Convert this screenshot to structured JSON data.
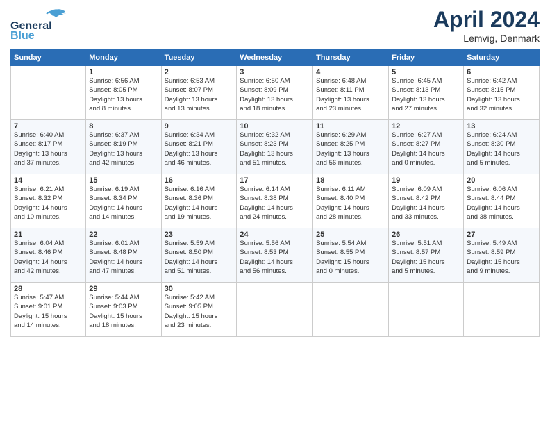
{
  "header": {
    "logo_general": "General",
    "logo_blue": "Blue",
    "title": "April 2024",
    "location": "Lemvig, Denmark"
  },
  "days_of_week": [
    "Sunday",
    "Monday",
    "Tuesday",
    "Wednesday",
    "Thursday",
    "Friday",
    "Saturday"
  ],
  "weeks": [
    [
      {
        "day": "",
        "info": ""
      },
      {
        "day": "1",
        "info": "Sunrise: 6:56 AM\nSunset: 8:05 PM\nDaylight: 13 hours\nand 8 minutes."
      },
      {
        "day": "2",
        "info": "Sunrise: 6:53 AM\nSunset: 8:07 PM\nDaylight: 13 hours\nand 13 minutes."
      },
      {
        "day": "3",
        "info": "Sunrise: 6:50 AM\nSunset: 8:09 PM\nDaylight: 13 hours\nand 18 minutes."
      },
      {
        "day": "4",
        "info": "Sunrise: 6:48 AM\nSunset: 8:11 PM\nDaylight: 13 hours\nand 23 minutes."
      },
      {
        "day": "5",
        "info": "Sunrise: 6:45 AM\nSunset: 8:13 PM\nDaylight: 13 hours\nand 27 minutes."
      },
      {
        "day": "6",
        "info": "Sunrise: 6:42 AM\nSunset: 8:15 PM\nDaylight: 13 hours\nand 32 minutes."
      }
    ],
    [
      {
        "day": "7",
        "info": "Sunrise: 6:40 AM\nSunset: 8:17 PM\nDaylight: 13 hours\nand 37 minutes."
      },
      {
        "day": "8",
        "info": "Sunrise: 6:37 AM\nSunset: 8:19 PM\nDaylight: 13 hours\nand 42 minutes."
      },
      {
        "day": "9",
        "info": "Sunrise: 6:34 AM\nSunset: 8:21 PM\nDaylight: 13 hours\nand 46 minutes."
      },
      {
        "day": "10",
        "info": "Sunrise: 6:32 AM\nSunset: 8:23 PM\nDaylight: 13 hours\nand 51 minutes."
      },
      {
        "day": "11",
        "info": "Sunrise: 6:29 AM\nSunset: 8:25 PM\nDaylight: 13 hours\nand 56 minutes."
      },
      {
        "day": "12",
        "info": "Sunrise: 6:27 AM\nSunset: 8:27 PM\nDaylight: 14 hours\nand 0 minutes."
      },
      {
        "day": "13",
        "info": "Sunrise: 6:24 AM\nSunset: 8:30 PM\nDaylight: 14 hours\nand 5 minutes."
      }
    ],
    [
      {
        "day": "14",
        "info": "Sunrise: 6:21 AM\nSunset: 8:32 PM\nDaylight: 14 hours\nand 10 minutes."
      },
      {
        "day": "15",
        "info": "Sunrise: 6:19 AM\nSunset: 8:34 PM\nDaylight: 14 hours\nand 14 minutes."
      },
      {
        "day": "16",
        "info": "Sunrise: 6:16 AM\nSunset: 8:36 PM\nDaylight: 14 hours\nand 19 minutes."
      },
      {
        "day": "17",
        "info": "Sunrise: 6:14 AM\nSunset: 8:38 PM\nDaylight: 14 hours\nand 24 minutes."
      },
      {
        "day": "18",
        "info": "Sunrise: 6:11 AM\nSunset: 8:40 PM\nDaylight: 14 hours\nand 28 minutes."
      },
      {
        "day": "19",
        "info": "Sunrise: 6:09 AM\nSunset: 8:42 PM\nDaylight: 14 hours\nand 33 minutes."
      },
      {
        "day": "20",
        "info": "Sunrise: 6:06 AM\nSunset: 8:44 PM\nDaylight: 14 hours\nand 38 minutes."
      }
    ],
    [
      {
        "day": "21",
        "info": "Sunrise: 6:04 AM\nSunset: 8:46 PM\nDaylight: 14 hours\nand 42 minutes."
      },
      {
        "day": "22",
        "info": "Sunrise: 6:01 AM\nSunset: 8:48 PM\nDaylight: 14 hours\nand 47 minutes."
      },
      {
        "day": "23",
        "info": "Sunrise: 5:59 AM\nSunset: 8:50 PM\nDaylight: 14 hours\nand 51 minutes."
      },
      {
        "day": "24",
        "info": "Sunrise: 5:56 AM\nSunset: 8:53 PM\nDaylight: 14 hours\nand 56 minutes."
      },
      {
        "day": "25",
        "info": "Sunrise: 5:54 AM\nSunset: 8:55 PM\nDaylight: 15 hours\nand 0 minutes."
      },
      {
        "day": "26",
        "info": "Sunrise: 5:51 AM\nSunset: 8:57 PM\nDaylight: 15 hours\nand 5 minutes."
      },
      {
        "day": "27",
        "info": "Sunrise: 5:49 AM\nSunset: 8:59 PM\nDaylight: 15 hours\nand 9 minutes."
      }
    ],
    [
      {
        "day": "28",
        "info": "Sunrise: 5:47 AM\nSunset: 9:01 PM\nDaylight: 15 hours\nand 14 minutes."
      },
      {
        "day": "29",
        "info": "Sunrise: 5:44 AM\nSunset: 9:03 PM\nDaylight: 15 hours\nand 18 minutes."
      },
      {
        "day": "30",
        "info": "Sunrise: 5:42 AM\nSunset: 9:05 PM\nDaylight: 15 hours\nand 23 minutes."
      },
      {
        "day": "",
        "info": ""
      },
      {
        "day": "",
        "info": ""
      },
      {
        "day": "",
        "info": ""
      },
      {
        "day": "",
        "info": ""
      }
    ]
  ]
}
